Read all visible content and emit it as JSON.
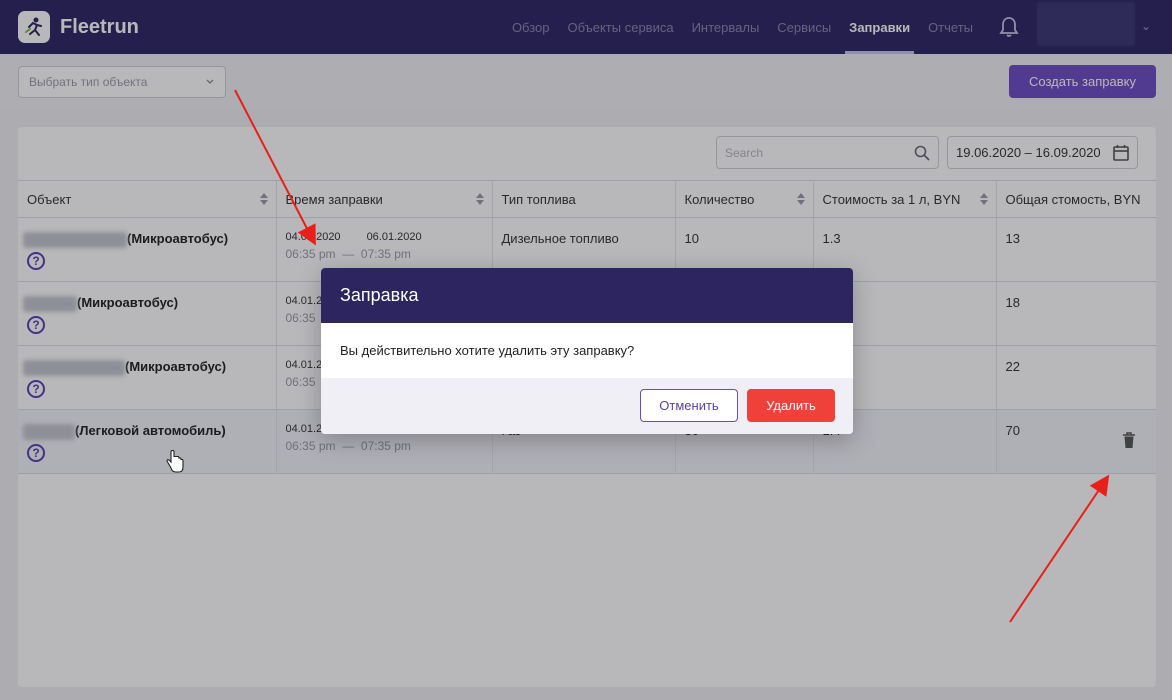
{
  "app": {
    "brand": "Fleetrun",
    "nav": [
      {
        "label": "Обзор",
        "active": false
      },
      {
        "label": "Объекты сервиса",
        "active": false
      },
      {
        "label": "Интервалы",
        "active": false
      },
      {
        "label": "Сервисы",
        "active": false
      },
      {
        "label": "Заправки",
        "active": true
      },
      {
        "label": "Отчеты",
        "active": false
      }
    ],
    "bell_icon": "bell-icon",
    "user_chevron": "chevron-down-icon"
  },
  "filter": {
    "object_type_placeholder": "Выбрать тип объекта",
    "create_button": "Создать заправку"
  },
  "toolbar": {
    "search_placeholder": "Search",
    "date_range": "19.06.2020 – 16.09.2020"
  },
  "table": {
    "columns": [
      {
        "label": "Объект",
        "sortable": true
      },
      {
        "label": "Время заправки",
        "sortable": true
      },
      {
        "label": "Тип топлива",
        "sortable": false
      },
      {
        "label": "Количество",
        "sortable": true
      },
      {
        "label": "Стоимость за 1 л, BYN",
        "sortable": true
      },
      {
        "label": "Общая стомость, BYN",
        "sortable": false
      }
    ],
    "rows": [
      {
        "object_type": "(Микроавтобус)",
        "date_start": "04.01.2020",
        "date_end": "06.01.2020",
        "time_start": "06:35 pm",
        "time_end": "07:35 pm",
        "fuel": "Дизельное топливо",
        "qty": "10",
        "price": "1.3",
        "total": "13"
      },
      {
        "object_type": "(Микроавтобус)",
        "date_start": "04.01.2",
        "date_end": "",
        "time_start": "06:35",
        "time_end": "",
        "fuel": "",
        "qty": "",
        "price": "",
        "total": "18"
      },
      {
        "object_type": "(Микроавтобус)",
        "date_start": "04.01.2",
        "date_end": "",
        "time_start": "06:35",
        "time_end": "",
        "fuel": "",
        "qty": "",
        "price": "",
        "total": "22"
      },
      {
        "object_type": "(Легковой автомобиль)",
        "date_start": "04.01.2",
        "date_end": "",
        "time_start": "06:35 pm",
        "time_end": "07:35 pm",
        "fuel": "Газ",
        "qty": "30",
        "price": "1.4",
        "total": "70"
      }
    ],
    "time_separator": "—"
  },
  "modal": {
    "title": "Заправка",
    "message": "Вы действительно хотите удалить эту заправку?",
    "cancel": "Отменить",
    "delete": "Удалить"
  },
  "colors": {
    "nav_bg": "#2c2560",
    "accent": "#6a4cc2",
    "danger": "#f0403a",
    "annotation_arrow": "#e8201a"
  }
}
